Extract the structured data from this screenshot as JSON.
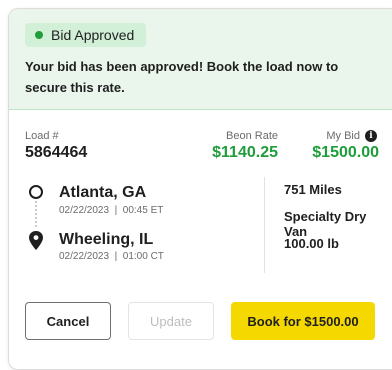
{
  "banner": {
    "status": "Bid Approved",
    "message": "Your bid has been approved! Book the load now to secure this rate."
  },
  "load": {
    "label": "Load #",
    "number": "5864464"
  },
  "rates": {
    "beon_label": "Beon Rate",
    "beon_value": "$1140.25",
    "mybid_label": "My Bid",
    "mybid_value": "$1500.00"
  },
  "route": {
    "origin": {
      "city": "Atlanta, GA",
      "date": "02/22/2023",
      "time": "00:45 ET"
    },
    "destination": {
      "city": "Wheeling, IL",
      "date": "02/22/2023",
      "time": "01:00 CT"
    }
  },
  "specs": {
    "miles": "751 Miles",
    "equipment": "Specialty Dry Van",
    "weight": "100.00 lb"
  },
  "actions": {
    "cancel": "Cancel",
    "update": "Update",
    "book": "Book for $1500.00"
  },
  "colors": {
    "accent_green": "#1f9d3a",
    "banner_bg": "#eaf6ec",
    "book_yellow": "#f4d800"
  }
}
